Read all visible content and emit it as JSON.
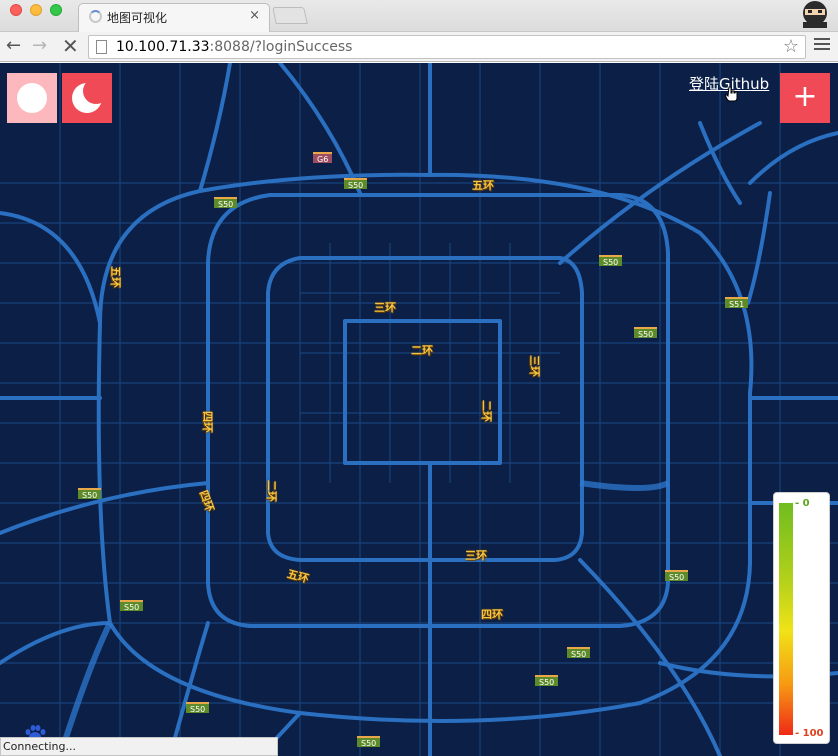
{
  "browser": {
    "tab_title": "地图可视化",
    "tab_close": "×",
    "url_host": "10.100.71.33",
    "url_rest": ":8088/?loginSuccess",
    "status": "Connecting..."
  },
  "overlay": {
    "login_label": "登陆Github",
    "add_label": "+"
  },
  "legend": {
    "max_label": "- 0",
    "min_label": "- 100",
    "gradient": [
      "#6fbd1f",
      "#b8d21a",
      "#f0e317",
      "#f79a12",
      "#ef2a17"
    ]
  },
  "colors": {
    "map_bg": "#0b1f47",
    "road": "#2a6fc0",
    "accent_red": "#ef4a55",
    "accent_pink": "#fdb8bd"
  },
  "map": {
    "shields": [
      {
        "label": "G6"
      },
      {
        "label": "S50"
      },
      {
        "label": "S50"
      },
      {
        "label": "S50"
      },
      {
        "label": "S51"
      },
      {
        "label": "S50"
      },
      {
        "label": "S50"
      },
      {
        "label": "S50"
      },
      {
        "label": "S50"
      },
      {
        "label": "S50"
      },
      {
        "label": "S50"
      },
      {
        "label": "S50"
      },
      {
        "label": "S50"
      }
    ],
    "road_labels": [
      "五环",
      "三环",
      "二环",
      "四环",
      "三环",
      "二环",
      "四环",
      "二环",
      "三环",
      "四环",
      "五环",
      "五环"
    ]
  }
}
